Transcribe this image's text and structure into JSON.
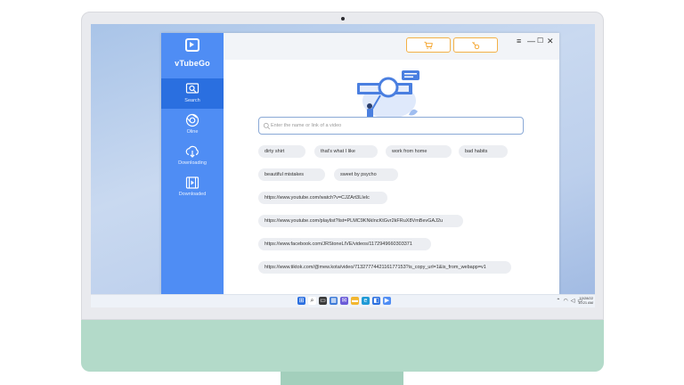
{
  "app": {
    "name": "vTubeGo"
  },
  "sidebar": {
    "items": [
      {
        "label": "Search",
        "icon": "search-icon",
        "active": true
      },
      {
        "label": "Oline",
        "icon": "globe-icon",
        "active": false
      },
      {
        "label": "Downloading",
        "icon": "download-icon",
        "active": false
      },
      {
        "label": "Downloaded",
        "icon": "film-icon",
        "active": false
      }
    ]
  },
  "topbar": {
    "buttons": [
      "cart-icon",
      "key-icon"
    ],
    "window_controls": [
      "≡",
      "—",
      "☐",
      "✕"
    ]
  },
  "search": {
    "placeholder": "Enter the name or link of a video",
    "value": ""
  },
  "suggestions": {
    "keywords": [
      "dirty shirt",
      "that's what I like",
      "work from home",
      "bad habits",
      "beautiful mistakes",
      "sweet by psycho"
    ],
    "links": [
      "https://www.youtube.com/watch?v=CJZArt3LIelc",
      "https://www.youtube.com/playlist?list=PLMC9KNkIncKtGvr2kFRuX8VmBevGAJ2u",
      "https://www.facebook.com/JRStoneLIVE/videos/1172949660303371",
      "https://www.tiktok.com/@mew.kota/video/7132777442116177153?is_copy_url=1&is_from_webapp=v1"
    ]
  },
  "taskbar": {
    "clock_time": "10/28/22",
    "clock_date": "10:21 AM"
  },
  "colors": {
    "sidebar": "#4f8df4",
    "sidebar_active": "#2a6fe0",
    "accent_orange": "#f3b046",
    "monitor_chin": "#b3dac9"
  }
}
